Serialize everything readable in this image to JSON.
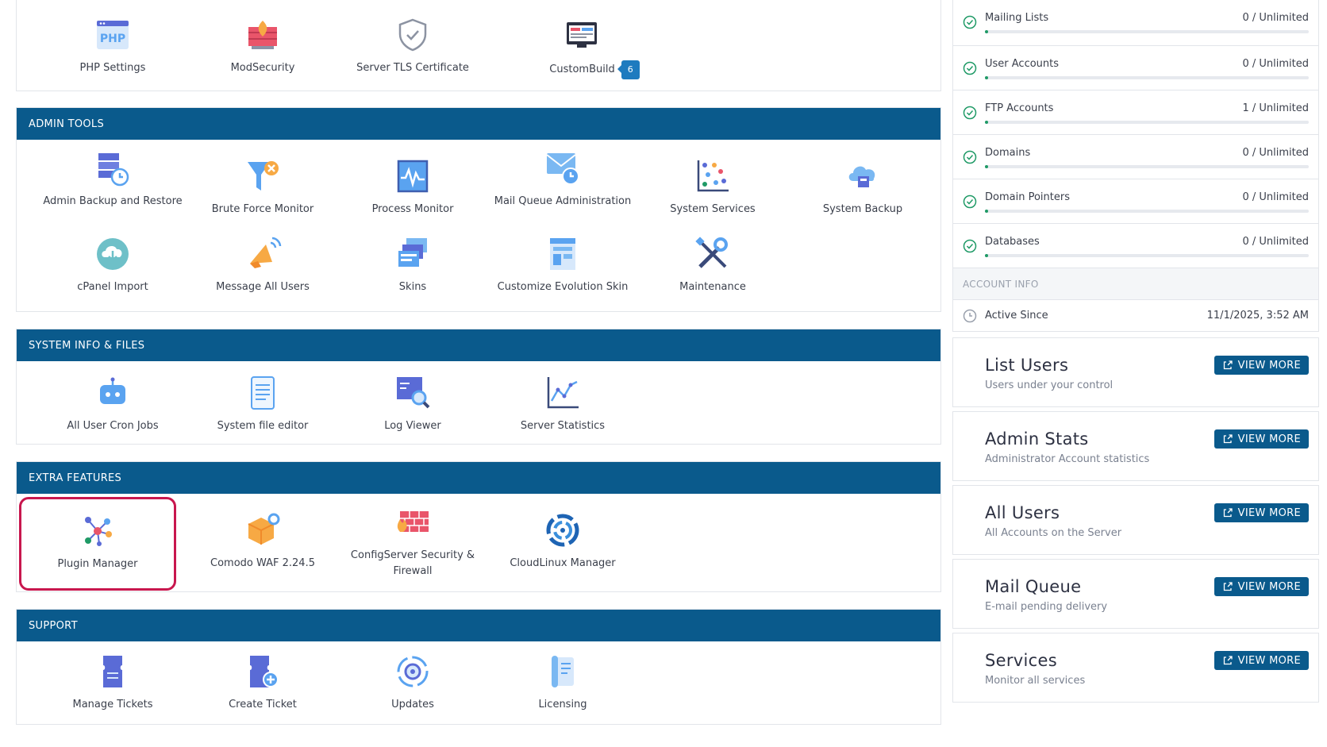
{
  "top_panel": {
    "items": [
      {
        "label": "PHP Settings",
        "icon": "php-icon"
      },
      {
        "label": "ModSecurity",
        "icon": "modsecurity-icon"
      },
      {
        "label": "Server TLS Certificate",
        "icon": "shield-check-icon"
      },
      {
        "label": "CustomBuild",
        "icon": "custombuild-icon",
        "badge": "6"
      }
    ]
  },
  "admin_tools": {
    "title": "ADMIN TOOLS",
    "items": [
      {
        "label": "Admin Backup and Restore",
        "icon": "backup-server-icon"
      },
      {
        "label": "Brute Force Monitor",
        "icon": "funnel-icon"
      },
      {
        "label": "Process Monitor",
        "icon": "process-monitor-icon"
      },
      {
        "label": "Mail Queue Administration",
        "icon": "mail-clock-icon"
      },
      {
        "label": "System Services",
        "icon": "scatter-chart-icon"
      },
      {
        "label": "System Backup",
        "icon": "cloud-backup-icon"
      },
      {
        "label": "cPanel Import",
        "icon": "cloud-download-icon"
      },
      {
        "label": "Message All Users",
        "icon": "megaphone-icon"
      },
      {
        "label": "Skins",
        "icon": "skins-icon"
      },
      {
        "label": "Customize Evolution Skin",
        "icon": "layout-icon"
      },
      {
        "label": "Maintenance",
        "icon": "tools-icon"
      }
    ]
  },
  "system_info": {
    "title": "SYSTEM INFO & FILES",
    "items": [
      {
        "label": "All User Cron Jobs",
        "icon": "robot-icon"
      },
      {
        "label": "System file editor",
        "icon": "file-text-icon"
      },
      {
        "label": "Log Viewer",
        "icon": "log-search-icon"
      },
      {
        "label": "Server Statistics",
        "icon": "line-chart-icon"
      }
    ]
  },
  "extra_features": {
    "title": "EXTRA FEATURES",
    "items": [
      {
        "label": "Plugin Manager",
        "icon": "plugin-network-icon"
      },
      {
        "label": "Comodo WAF 2.24.5",
        "icon": "package-gear-icon"
      },
      {
        "label": "ConfigServer Security & Firewall",
        "icon": "firewall-icon"
      },
      {
        "label": "CloudLinux Manager",
        "icon": "cloudlinux-icon"
      }
    ]
  },
  "support": {
    "title": "SUPPORT",
    "items": [
      {
        "label": "Manage Tickets",
        "icon": "ticket-icon"
      },
      {
        "label": "Create Ticket",
        "icon": "ticket-add-icon"
      },
      {
        "label": "Updates",
        "icon": "updates-gear-icon"
      },
      {
        "label": "Licensing",
        "icon": "license-scroll-icon"
      }
    ]
  },
  "usage": [
    {
      "name": "Mailing Lists",
      "value": "0 / Unlimited"
    },
    {
      "name": "User Accounts",
      "value": "0 / Unlimited"
    },
    {
      "name": "FTP Accounts",
      "value": "1 / Unlimited"
    },
    {
      "name": "Domains",
      "value": "0 / Unlimited"
    },
    {
      "name": "Domain Pointers",
      "value": "0 / Unlimited"
    },
    {
      "name": "Databases",
      "value": "0 / Unlimited"
    }
  ],
  "account_info": {
    "title": "ACCOUNT INFO",
    "active_since_label": "Active Since",
    "active_since_value": "11/1/2025, 3:52 AM"
  },
  "cards": [
    {
      "title": "List Users",
      "subtitle": "Users under your control",
      "button": "VIEW MORE"
    },
    {
      "title": "Admin Stats",
      "subtitle": "Administrator Account statistics",
      "button": "VIEW MORE"
    },
    {
      "title": "All Users",
      "subtitle": "All Accounts on the Server",
      "button": "VIEW MORE"
    },
    {
      "title": "Mail Queue",
      "subtitle": "E-mail pending delivery",
      "button": "VIEW MORE"
    },
    {
      "title": "Services",
      "subtitle": "Monitor all services",
      "button": "VIEW MORE"
    }
  ],
  "colors": {
    "header_blue": "#0a5a8c",
    "highlight_border": "#c8174e",
    "progress_green": "#1f9a66",
    "badge_blue": "#1e7bbf"
  }
}
